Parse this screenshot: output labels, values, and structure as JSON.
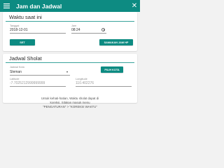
{
  "appbar": {
    "title": "Jam dan Jadwal",
    "menu_icon": "hamburger-menu-icon",
    "close_icon": "close-icon",
    "color": "#0d8b82"
  },
  "time_section": {
    "title": "Waktu saat ini",
    "date_label": "Tanggal",
    "date_value": "2018-12-01",
    "time_label": "Jam",
    "time_value": "08:24",
    "time_icon": "clock-icon",
    "set_button": "SET",
    "sync_button": "SAMAKAN JAM HP"
  },
  "schedule_section": {
    "title": "Jadwal Sholat",
    "city_label": "Jadwal Kota",
    "city_value": "Sleman",
    "city_dropdown_icon": "caret-down-icon",
    "choose_city_button": "PILIH KOTA",
    "latitude_label": "Latitude",
    "latitude_value": "-7.7025212999999999",
    "longitude_label": "Longitude",
    "longitude_value": "110.402276"
  },
  "info": {
    "line1": "Untuk kehati-hatian, Waktu sholat dapat di",
    "line2": "koreksi. Silakan masuk menu",
    "line3": "\"PENGATURAN\" > \"KOREKSI WAKTU\""
  }
}
